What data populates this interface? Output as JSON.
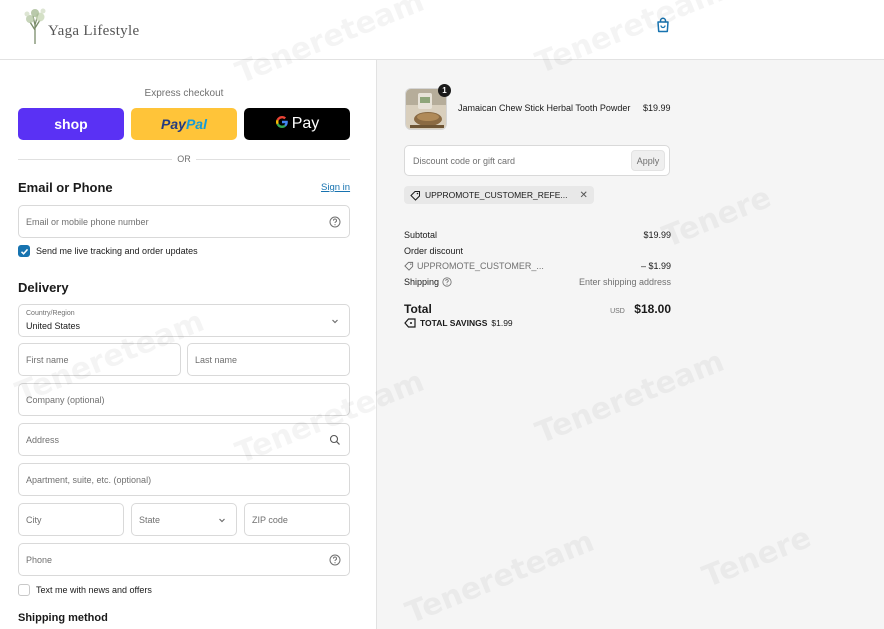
{
  "header": {
    "brand": "Yaga Lifestyle",
    "cart_icon": "shopping-bag-icon"
  },
  "express": {
    "title": "Express checkout",
    "shop_label": "shop",
    "paypal_label_1": "Pay",
    "paypal_label_2": "Pal",
    "gpay_g": "G",
    "gpay_label": "Pay",
    "or_label": "OR"
  },
  "contact": {
    "title": "Email or Phone",
    "sign_in": "Sign in",
    "placeholder": "Email or mobile phone number",
    "tracking_label": "Send me live tracking and order updates",
    "tracking_checked": true
  },
  "delivery": {
    "title": "Delivery",
    "country_label": "Country/Region",
    "country_value": "United States",
    "first_name": "First name",
    "last_name": "Last name",
    "company": "Company (optional)",
    "address": "Address",
    "apartment": "Apartment, suite, etc. (optional)",
    "city": "City",
    "state": "State",
    "zip": "ZIP code",
    "phone": "Phone",
    "news_label": "Text me with news and offers",
    "news_checked": false
  },
  "shipping_method": {
    "title": "Shipping method"
  },
  "order": {
    "quantity": "1",
    "product_name": "Jamaican Chew Stick Herbal Tooth Powder",
    "product_price": "$19.99",
    "discount_placeholder": "Discount code or gift card",
    "apply_label": "Apply",
    "applied_code": "UPPROMOTE_CUSTOMER_REFE...",
    "subtotal_label": "Subtotal",
    "subtotal_value": "$19.99",
    "order_discount_label": "Order discount",
    "discount_code_short": "UPPROMOTE_CUSTOMER_...",
    "discount_value": "– $1.99",
    "shipping_label": "Shipping",
    "shipping_value": "Enter shipping address",
    "total_label": "Total",
    "currency": "USD",
    "total_value": "$18.00",
    "savings_label": "TOTAL SAVINGS",
    "savings_value": "$1.99"
  },
  "colors": {
    "shop": "#5a31f4",
    "paypal": "#ffc439",
    "gpay": "#000000",
    "link": "#1773b0",
    "summary_bg": "#f5f5f5"
  }
}
